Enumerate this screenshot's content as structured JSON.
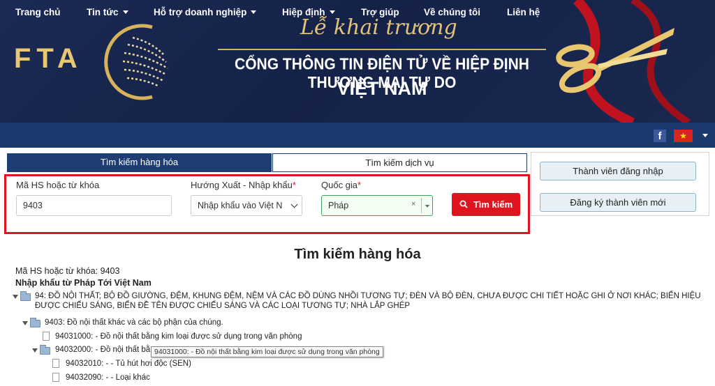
{
  "banner": {
    "logo": "FTA",
    "headline_script": "Lễ khai trương",
    "headline_main": "CỔNG THÔNG TIN ĐIỆN TỬ VỀ HIỆP ĐỊNH THƯƠNG MẠI TỰ DO",
    "headline_sub": "VIỆT NAM",
    "accent_color": "#d6b35a",
    "background_color": "#1b2a55"
  },
  "nav": {
    "items": [
      {
        "label": "Trang chủ",
        "dropdown": false
      },
      {
        "label": "Tin tức",
        "dropdown": true
      },
      {
        "label": "Hỗ trợ doanh nghiệp",
        "dropdown": true
      },
      {
        "label": "Hiệp định",
        "dropdown": true
      },
      {
        "label": "Trợ giúp",
        "dropdown": false
      },
      {
        "label": "Về chúng tôi",
        "dropdown": false
      },
      {
        "label": "Liên hệ",
        "dropdown": false
      }
    ],
    "facebook_icon": "f",
    "language_flag_icon": "★",
    "background_color": "#1a3a6e"
  },
  "tabs": {
    "goods": "Tìm kiếm hàng hóa",
    "service": "Tìm kiếm dịch vụ"
  },
  "search": {
    "hs_label": "Mã HS hoặc từ khóa",
    "hs_value": "9403",
    "direction_label": "Hướng Xuất - Nhập khẩu",
    "direction_required": "*",
    "direction_value": "Nhập khẩu vào Việt N",
    "country_label": "Quốc gia",
    "country_required": "*",
    "country_value": "Pháp",
    "clear_icon": "×",
    "button_label": "Tìm kiếm",
    "highlight_color": "#e0141e"
  },
  "side": {
    "login": "Thành viên đăng nhập",
    "register": "Đăng ký thành viên mới"
  },
  "results": {
    "title": "Tìm kiếm hàng hóa",
    "query_line": "Mã HS hoặc từ khóa: 9403",
    "route_line": "Nhập khẩu từ Pháp Tới Việt Nam",
    "tree": [
      {
        "text": "94: ĐỒ NỘI THẤT; BỘ ĐỒ GIƯỜNG, ĐỆM, KHUNG ĐỆM, NỆM VÀ CÁC ĐỒ DÙNG NHỒI TƯƠNG TỰ; ĐÈN VÀ BỘ ĐÈN, CHƯA ĐƯỢC CHI TIẾT HOẶC GHI Ở NƠI KHÁC; BIỂN HIỆU",
        "cont": "ĐƯỢC CHIẾU SÁNG, BIỂN ĐỀ TÊN ĐƯỢC CHIẾU SÁNG VÀ CÁC LOẠI TƯƠNG TỰ; NHÀ LẮP GHÉP"
      },
      {
        "text": "9403: Đồ nội thất khác và các bộ phận của chúng."
      },
      {
        "text": "94031000: - Đồ nội thất bằng kim loại được sử dụng trong văn phòng"
      },
      {
        "text": "94032000: - Đồ nội thất bằ"
      },
      {
        "text": "94032010: - - Tủ hút hơi độc (SEN)"
      },
      {
        "text": "94032090: - - Loại khác"
      }
    ],
    "tooltip": "94031000: - Đồ nội thất bằng kim loại được sử dụng trong văn phòng"
  }
}
